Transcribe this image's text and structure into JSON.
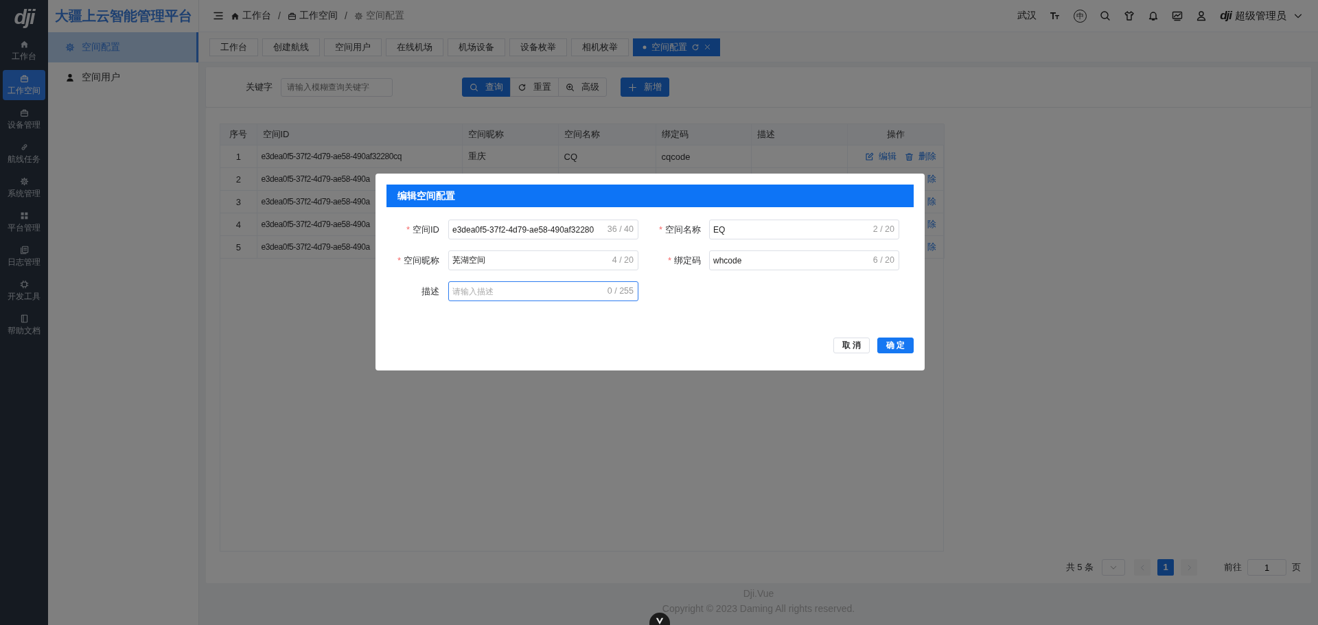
{
  "rail": {
    "logo": "dji",
    "items": [
      {
        "label": "工作台",
        "selected": false
      },
      {
        "label": "工作空间",
        "selected": true
      },
      {
        "label": "设备管理",
        "selected": false
      },
      {
        "label": "航线任务",
        "selected": false
      },
      {
        "label": "系统管理",
        "selected": false
      },
      {
        "label": "平台管理",
        "selected": false
      },
      {
        "label": "日志管理",
        "selected": false
      },
      {
        "label": "开发工具",
        "selected": false
      },
      {
        "label": "帮助文档",
        "selected": false
      }
    ]
  },
  "sidebar": {
    "title": "大疆上云智能管理平台",
    "items": [
      {
        "label": "空间配置",
        "selected": true
      },
      {
        "label": "空间用户",
        "selected": false
      }
    ]
  },
  "header": {
    "breadcrumb": [
      {
        "label": "工作台",
        "separator": "/"
      },
      {
        "label": "工作空间",
        "separator": "/"
      },
      {
        "label": "空间配置"
      }
    ],
    "city": "武汉",
    "language": "中",
    "logo": "dji",
    "user": "超级管理员"
  },
  "tabs": [
    {
      "label": "工作台",
      "selected": false
    },
    {
      "label": "创建航线",
      "selected": false
    },
    {
      "label": "空间用户",
      "selected": false
    },
    {
      "label": "在线机场",
      "selected": false
    },
    {
      "label": "机场设备",
      "selected": false
    },
    {
      "label": "设备枚举",
      "selected": false
    },
    {
      "label": "相机枚举",
      "selected": false
    },
    {
      "label": "空间配置",
      "selected": true
    }
  ],
  "search": {
    "label": "关键字",
    "placeholder": "请输入模糊查询关键字",
    "buttons": [
      {
        "label": "查询",
        "kind": "group_primary"
      },
      {
        "label": "重置",
        "kind": "group_plain"
      },
      {
        "label": "高级",
        "kind": "group_plain"
      },
      {
        "label": "新增",
        "kind": "primary"
      }
    ]
  },
  "table": {
    "columns": [
      "序号",
      "空间ID",
      "空间昵称",
      "空间名称",
      "绑定码",
      "描述",
      "操作"
    ],
    "rows": [
      {
        "index": "1",
        "id": "e3dea0f5-37f2-4d79-ae58-490af32280cq",
        "nickname": "重庆",
        "name": "CQ",
        "code": "cqcode",
        "actions": [
          {
            "label": "编辑",
            "kind": "edit"
          },
          {
            "label": "删除",
            "kind": "delete"
          }
        ]
      },
      {
        "index": "2",
        "id": "e3dea0f5-37f2-4d79-ae58-490a",
        "actions": [
          {
            "label": "除",
            "kind": "delete_cut"
          }
        ]
      },
      {
        "index": "3",
        "id": "e3dea0f5-37f2-4d79-ae58-490a",
        "actions": [
          {
            "label": "除",
            "kind": "delete_cut"
          }
        ]
      },
      {
        "index": "4",
        "id": "e3dea0f5-37f2-4d79-ae58-490a",
        "actions": [
          {
            "label": "除",
            "kind": "delete_cut"
          }
        ]
      },
      {
        "index": "5",
        "id": "e3dea0f5-37f2-4d79-ae58-490a",
        "actions": [
          {
            "label": "除",
            "kind": "delete_cut"
          }
        ]
      }
    ]
  },
  "pagination": {
    "total": "共 5 条",
    "pages": [
      {
        "label": "1",
        "selected": true
      }
    ],
    "goto_label": "前往",
    "goto_value": "1",
    "goto_suffix": "页"
  },
  "footer": {
    "name": "Dji.Vue",
    "copyright": "Copyright © 2023 Daming All rights reserved."
  },
  "dialog": {
    "title": "编辑空间配置",
    "fields": [
      {
        "label": "空间ID",
        "required_mark": "*",
        "value": "e3dea0f5-37f2-4d79-ae58-490af32280",
        "count": "36 / 40",
        "focused": false
      },
      {
        "label": "空间名称",
        "required_mark": "*",
        "value": "EQ",
        "count": "2 / 20",
        "focused": false
      },
      {
        "label": "空间昵称",
        "required_mark": "*",
        "value": "芜湖空间",
        "count": "4 / 20",
        "focused": false
      },
      {
        "label": "绑定码",
        "required_mark": "*",
        "value": "whcode",
        "count": "6 / 20",
        "focused": false
      },
      {
        "label": "描述",
        "placeholder": "请输入描述",
        "count": "0 / 255",
        "focused": true
      }
    ],
    "buttons": [
      {
        "label": "取 消",
        "kind": "plain"
      },
      {
        "label": "确 定",
        "kind": "primary"
      }
    ]
  }
}
